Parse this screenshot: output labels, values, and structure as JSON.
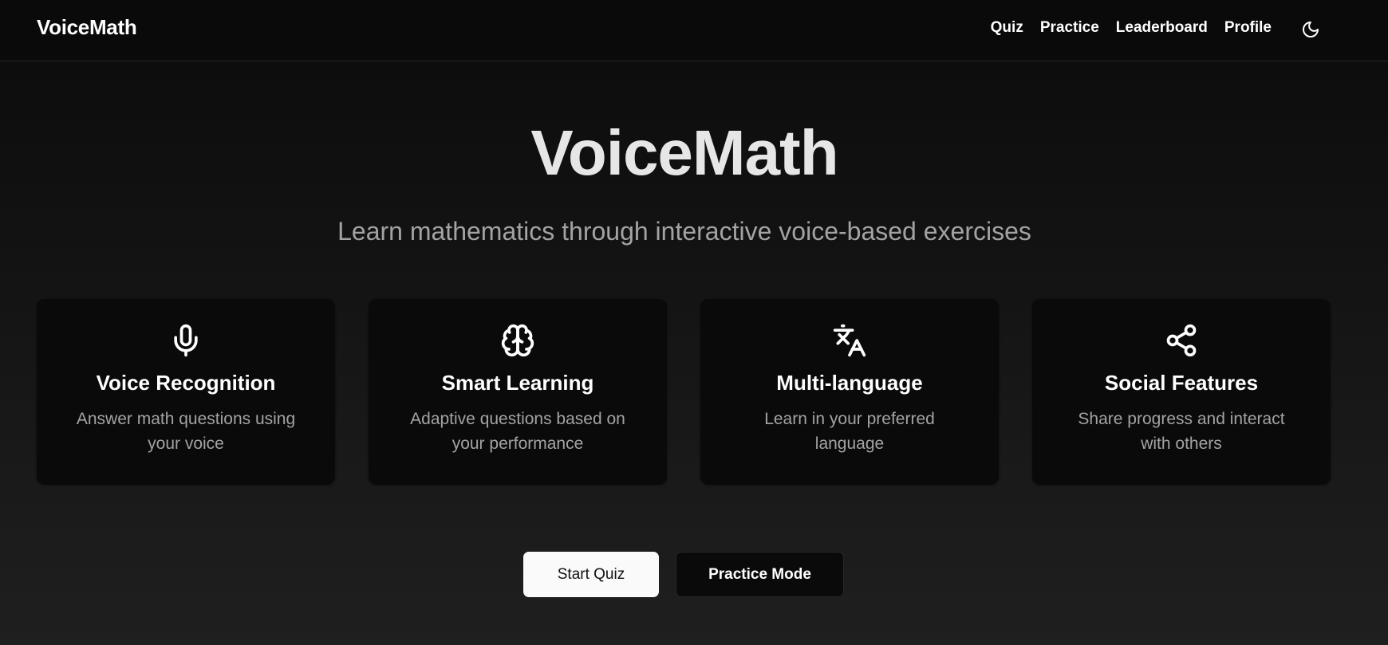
{
  "header": {
    "brand": "VoiceMath",
    "nav": [
      {
        "label": "Quiz"
      },
      {
        "label": "Practice"
      },
      {
        "label": "Leaderboard"
      },
      {
        "label": "Profile"
      }
    ],
    "theme_toggle_icon": "moon-icon"
  },
  "hero": {
    "title": "VoiceMath",
    "subtitle": "Learn mathematics through interactive voice-based exercises"
  },
  "features": [
    {
      "icon": "microphone-icon",
      "title": "Voice Recognition",
      "description": "Answer math questions using your voice"
    },
    {
      "icon": "brain-icon",
      "title": "Smart Learning",
      "description": "Adaptive questions based on your performance"
    },
    {
      "icon": "languages-icon",
      "title": "Multi-language",
      "description": "Learn in your preferred language"
    },
    {
      "icon": "share-icon",
      "title": "Social Features",
      "description": "Share progress and interact with others"
    }
  ],
  "actions": {
    "start_quiz": "Start Quiz",
    "practice_mode": "Practice Mode"
  },
  "colors": {
    "background": "#0b0b0b",
    "card": "#0a0a0a",
    "text": "#ffffff",
    "muted_text": "#a3a3a3",
    "primary_button": "#fafafa"
  }
}
